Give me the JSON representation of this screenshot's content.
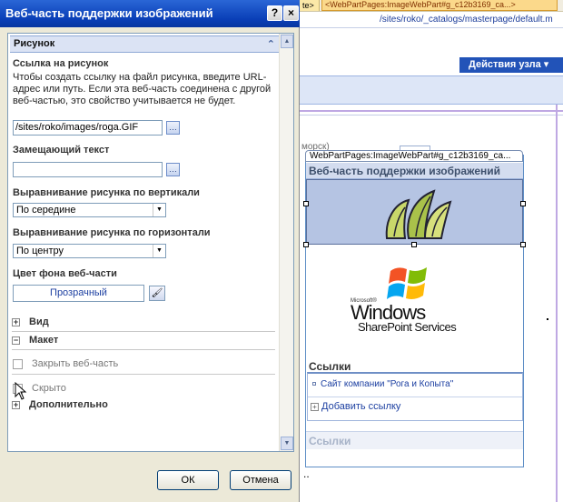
{
  "page": {
    "tab_short": "te>",
    "tab_long": "<WebPartPages:ImageWebPart#g_c12b3169_ca...>",
    "url": "/sites/roko/_catalogs/masterpage/default.m",
    "site_actions": "Действия узла ▾",
    "hint_fragment": "морск)",
    "webpart_tag": "WebPartPages:ImageWebPart#g_c12b3169_ca...",
    "webpart_title": "Веб-часть поддержки изображений",
    "logo": {
      "microsoft": "Microsoft®",
      "windows": "Windows",
      "sharepoint": "SharePoint Services"
    },
    "links_title": "Ссылки",
    "links_item": "Сайт компании \"Рога и Копыта\"",
    "add_link": "Добавить ссылку",
    "links2_title": "Ссылки",
    "trailing_dots": ".."
  },
  "dialog": {
    "title": "Веб-часть поддержки изображений",
    "help_label": "?",
    "close_label": "×",
    "section_title": "Рисунок",
    "image_link_label": "Ссылка на рисунок",
    "image_link_desc": "Чтобы создать ссылку на файл рисунка, введите URL-адрес или путь. Если эта веб-часть соединена с другой веб-частью, это свойство учитывается не будет.",
    "image_link_value": "/sites/roko/images/roga.GIF",
    "alt_text_label": "Замещающий текст",
    "alt_text_value": "",
    "valign_label": "Выравнивание рисунка по вертикали",
    "valign_value": "По середине",
    "halign_label": "Выравнивание рисунка по горизонтали",
    "halign_value": "По центру",
    "bgcolor_label": "Цвет фона веб-части",
    "bgcolor_value": "Прозрачный",
    "view_label": "Вид",
    "layout_label": "Макет",
    "close_webpart_label": "Закрыть веб-часть",
    "hidden_label": "Скрыто",
    "advanced_label": "Дополнительно",
    "ok_label": "ОК",
    "cancel_label": "Отмена"
  }
}
